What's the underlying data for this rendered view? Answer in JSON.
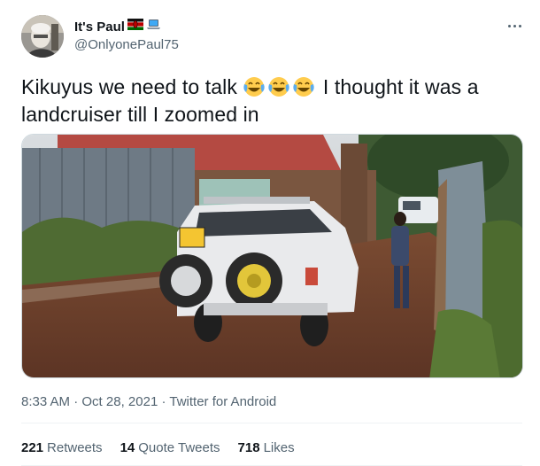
{
  "user": {
    "display_name": "It's Paul",
    "flag_icon": "kenya-flag-icon",
    "laptop_icon": "laptop-emoji-icon",
    "handle": "@OnlyonePaul75"
  },
  "tweet": {
    "text_before": "Kikuyus we need to talk ",
    "emoji": "face-with-tears-of-joy-icon",
    "text_after": " I thought it was a landcruiser till I zoomed in",
    "image_icon": "car-photo"
  },
  "meta": {
    "time": "8:33 AM",
    "separator": "·",
    "date": "Oct 28, 2021",
    "source": "Twitter for Android"
  },
  "stats": {
    "retweets_count": "221",
    "retweets_label": "Retweets",
    "quotes_count": "14",
    "quotes_label": "Quote Tweets",
    "likes_count": "718",
    "likes_label": "Likes"
  },
  "colors": {
    "text": "#0f1419",
    "secondary": "#536471",
    "border": "#cfd9de"
  }
}
